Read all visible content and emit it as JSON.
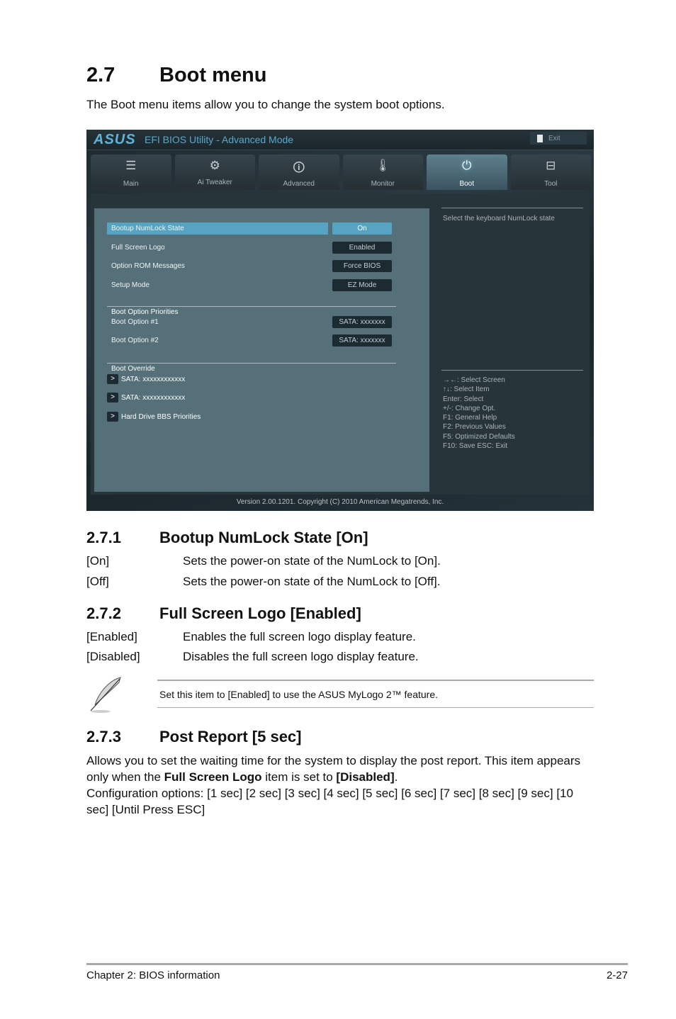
{
  "heading": {
    "number": "2.7",
    "title": "Boot menu"
  },
  "intro": "The Boot menu items allow you to change the system boot options.",
  "bios": {
    "logo": "ASUS",
    "title": "EFI BIOS Utility - Advanced Mode",
    "exit_label": "Exit",
    "tabs": [
      {
        "label": "Main",
        "icon": "list-icon",
        "glyph": "☰"
      },
      {
        "label": "Ai  Tweaker",
        "icon": "tweaker-icon",
        "glyph": "⚙"
      },
      {
        "label": "Advanced",
        "icon": "advanced-info-icon",
        "glyph": "🛈"
      },
      {
        "label": "Monitor",
        "icon": "thermometer-gauge-icon",
        "glyph": "🌡"
      },
      {
        "label": "Boot",
        "icon": "power-icon",
        "glyph": "⏻",
        "active": true
      },
      {
        "label": "Tool",
        "icon": "toolbox-icon",
        "glyph": "⊟"
      }
    ],
    "settings": [
      {
        "label": "Bootup NumLock State",
        "value": "On",
        "selected": true
      },
      {
        "label": "Full Screen Logo",
        "value": "Enabled"
      },
      {
        "label": "Option ROM Messages",
        "value": "Force BIOS"
      },
      {
        "label": "Setup Mode",
        "value": "EZ Mode"
      }
    ],
    "boot_priorities": {
      "title": "Boot Option Priorities",
      "items": [
        {
          "label": "Boot Option #1",
          "value": "SATA: xxxxxxx"
        },
        {
          "label": "Boot Option #2",
          "value": "SATA: xxxxxxx"
        }
      ]
    },
    "boot_override": {
      "title": "Boot Override",
      "arrow": ">",
      "items": [
        "SATA: xxxxxxxxxxxx",
        "SATA: xxxxxxxxxxxx",
        "Hard Drive BBS Priorities"
      ]
    },
    "help_text": "Select the keyboard NumLock state",
    "keys": [
      "→←:  Select Screen",
      "↑↓:  Select Item",
      "Enter:  Select",
      "+/-:  Change Opt.",
      "F1:  General Help",
      "F2:  Previous Values",
      "F5:  Optimized Defaults",
      "F10:  Save    ESC:  Exit"
    ],
    "version": "Version  2.00.1201.  Copyright  (C)  2010  American  Megatrends,  Inc.",
    "colors": {
      "accent": "#56a4c1",
      "panel": "#557079",
      "title": "#59a8cc"
    }
  },
  "sections": [
    {
      "number": "2.7.1",
      "title": "Bootup NumLock State [On]",
      "options": [
        {
          "key": "[On]",
          "desc": "Sets the power-on state of the NumLock to [On]."
        },
        {
          "key": "[Off]",
          "desc": "Sets the power-on state of the NumLock to [Off]."
        }
      ]
    },
    {
      "number": "2.7.2",
      "title": "Full Screen Logo [Enabled]",
      "options": [
        {
          "key": "[Enabled]",
          "desc": "Enables the full screen logo display feature."
        },
        {
          "key": "[Disabled]",
          "desc": "Disables the full screen logo display feature."
        }
      ]
    },
    {
      "number": "2.7.3",
      "title": "Post Report [5 sec]"
    }
  ],
  "note": "Set this item to [Enabled] to use the ASUS MyLogo 2™ feature.",
  "post_report": {
    "p1_a": "Allows you to set the waiting time for the system to display the post report. This item appears only when the ",
    "p1_bold1": "Full Screen Logo",
    "p1_b": " item is set to ",
    "p1_bold2": "[Disabled]",
    "p1_c": ".",
    "p2": "Configuration options: [1 sec] [2 sec] [3 sec] [4 sec] [5 sec] [6 sec] [7 sec] [8 sec] [9 sec] [10 sec] [Until Press ESC]"
  },
  "footer": {
    "left": "Chapter 2: BIOS information",
    "right": "2-27"
  }
}
